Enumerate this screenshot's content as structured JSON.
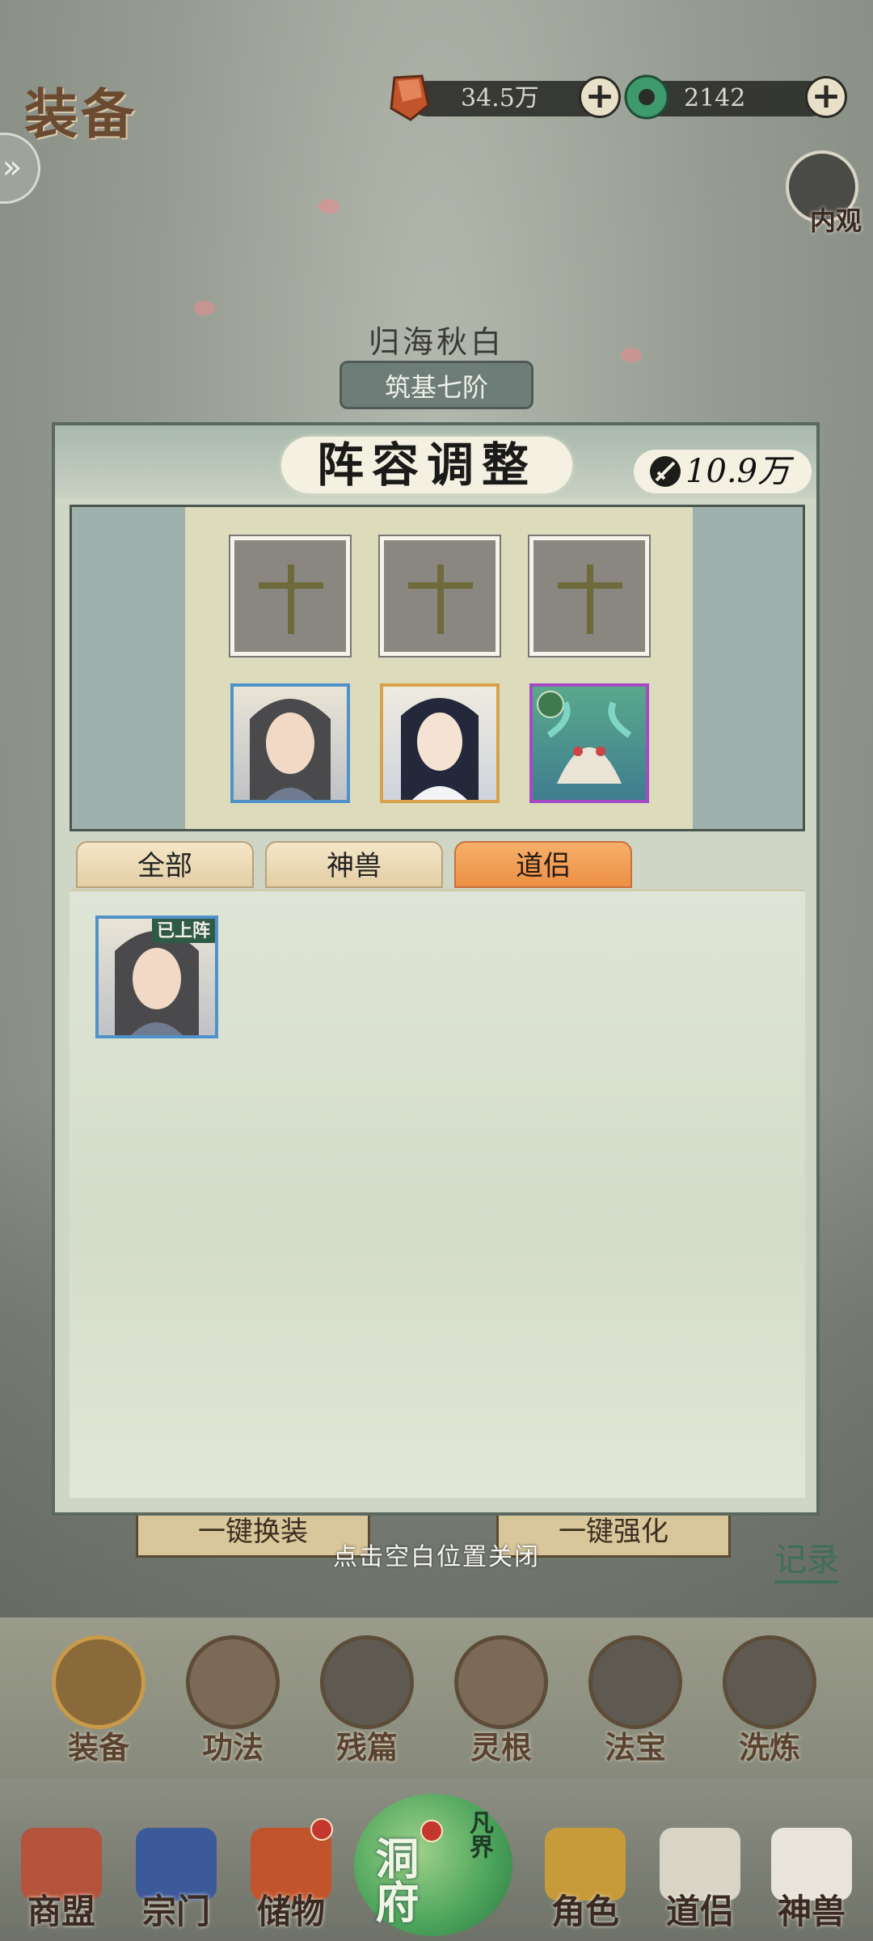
{
  "header": {
    "title": "装备",
    "currency1": {
      "value": "34.5万",
      "icon": "spirit-stone-icon"
    },
    "currency2": {
      "value": "2142",
      "icon": "jade-icon"
    },
    "neiguan_label": "内观"
  },
  "character": {
    "name": "归海秋白",
    "rank": "筑基七阶"
  },
  "modal": {
    "title": "阵容调整",
    "power": "10.9万",
    "lineup_top": [
      {
        "state": "empty"
      },
      {
        "state": "empty"
      },
      {
        "state": "empty"
      }
    ],
    "lineup_bottom": [
      {
        "type": "portrait",
        "color": "#4f92c9"
      },
      {
        "type": "portrait",
        "color": "#d8a24a"
      },
      {
        "type": "beast",
        "color": "#a44ac4"
      }
    ],
    "tabs": [
      {
        "label": "全部",
        "active": false
      },
      {
        "label": "神兽",
        "active": false
      },
      {
        "label": "道侣",
        "active": true
      }
    ],
    "list": [
      {
        "badge": "已上阵",
        "color": "#4f92c9"
      }
    ]
  },
  "under_buttons": [
    "一键换装",
    "一键强化"
  ],
  "close_hint": "点击空白位置关闭",
  "record_label": "记录",
  "sub_menu": [
    "装备",
    "功法",
    "残篇",
    "灵根",
    "法宝",
    "洗炼"
  ],
  "bottom_nav": {
    "items": [
      "商盟",
      "宗门",
      "储物",
      "角色",
      "道侣",
      "神兽"
    ],
    "center_label": "洞府",
    "center_sub": "凡界"
  }
}
